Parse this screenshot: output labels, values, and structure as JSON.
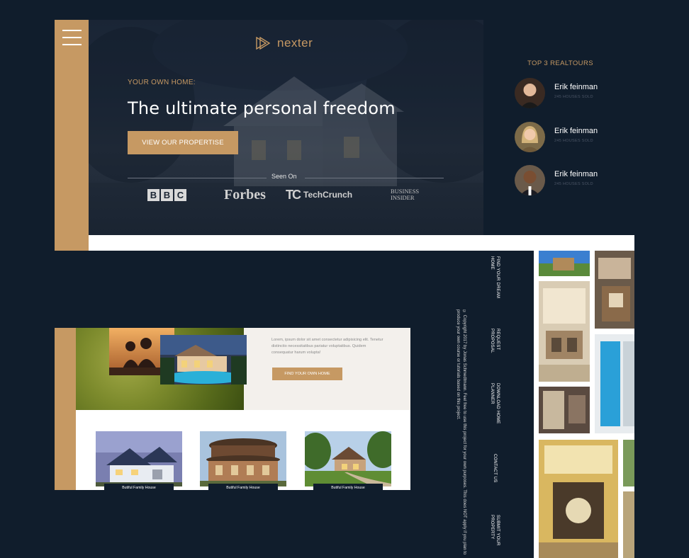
{
  "colors": {
    "background": "#101d2c",
    "accent": "#c69963",
    "white": "#ffffff"
  },
  "top": {
    "menu_icon": "hamburger-icon",
    "logo_icon": "triangle-play-icon",
    "logo_text": "nexter",
    "eyebrow": "YOUR OWN HOME:",
    "title": "The ultimate personal freedom",
    "cta": "VIEW OUR PROPERTISE",
    "seen_on": "Seen On",
    "press": {
      "bbc": [
        "B",
        "B",
        "C"
      ],
      "forbes": "Forbes",
      "techcrunch": "TechCrunch",
      "business_insider": [
        "BUSINESS",
        "INSIDER"
      ]
    }
  },
  "realtors": {
    "title": "TOP 3 REALTOURS",
    "items": [
      {
        "name": "Erik feinman",
        "sub": "245 HOUSES SOLD"
      },
      {
        "name": "Erik feinman",
        "sub": "245 HOUSES SOLD"
      },
      {
        "name": "Erik feinman",
        "sub": "245 HOUSES SOLD"
      }
    ]
  },
  "middle": {
    "text": "Lorem, ipsum dolor sit amet consectetur adipisicing elit. Tenetur distinctio necessitatibus pariatur voluptatibus. Quidem consequatur harum volupta!",
    "cta": "FIND YOUR OWN HOME",
    "cards": [
      {
        "label": "Butiful Family House"
      },
      {
        "label": "Butiful Family House"
      },
      {
        "label": "Butiful Family House"
      }
    ]
  },
  "vertical_nav": [
    "FIND YOUR DREAM HOME",
    "REQUEST PROPOSAL",
    "DOWNLOAD HOME PLANNER",
    "CONTACT US",
    "SUBMIT YOUR PROPERTY"
  ],
  "copyright": "© Copyright 2017 by Jonas Schmedtmann. Feel free to use this project for your own purposes. This does NOT apply if you plan to produce your own course or tutorials based on this project."
}
